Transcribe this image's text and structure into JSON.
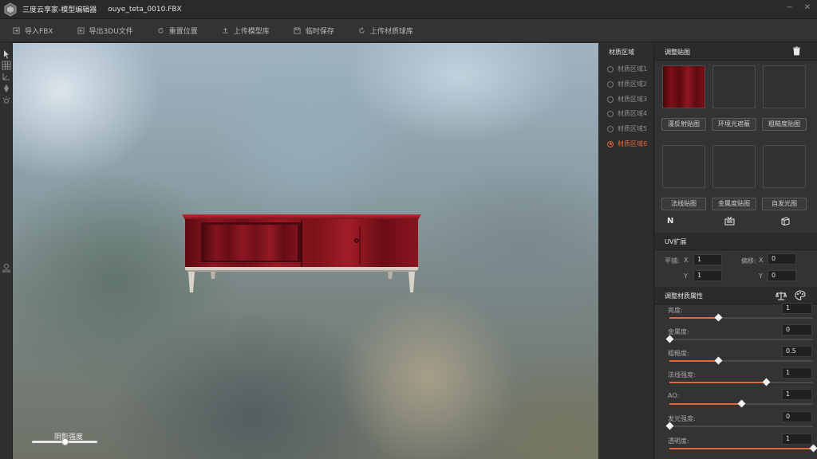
{
  "titlebar": {
    "app_title": "三度云享家-模型编辑器",
    "file_name": "ouye_teta_0010.FBX",
    "minimize": "−",
    "close": "✕"
  },
  "toolbar": [
    {
      "label": "导入FBX",
      "icon": "import-icon"
    },
    {
      "label": "导出3DU文件",
      "icon": "export-icon"
    },
    {
      "label": "重置位置",
      "icon": "reset-icon"
    },
    {
      "label": "上传模型库",
      "icon": "upload-icon"
    },
    {
      "label": "临时保存",
      "icon": "save-icon"
    },
    {
      "label": "上传材质球库",
      "icon": "sync-icon"
    }
  ],
  "viewport": {
    "shadow_label": "阴影强度",
    "shadow_value": 0.5
  },
  "regions": {
    "title": "材质区域",
    "items": [
      "材质区域1",
      "材质区域2",
      "材质区域3",
      "材质区域4",
      "材质区域5",
      "材质区域6"
    ],
    "selected_index": 5,
    "accent": "#e4663a"
  },
  "textures": {
    "title": "调整贴图",
    "buttons": [
      "漫反射贴图",
      "环境光遮蔽",
      "粗糙度贴图",
      "法线贴图",
      "金属度贴图",
      "自发光图"
    ],
    "normal_icon_text": "N"
  },
  "uv": {
    "title": "UV扩展",
    "tile_label": "平铺:",
    "offset_label": "偏移:",
    "x_label": "X",
    "y_label": "Y",
    "tile_x": "1",
    "tile_y": "1",
    "offset_x": "0",
    "offset_y": "0"
  },
  "material": {
    "title": "调整材质属性",
    "props": [
      {
        "label": "亮度:",
        "value": "1",
        "level": 0.34
      },
      {
        "label": "金属度:",
        "value": "0",
        "level": 0.0
      },
      {
        "label": "粗糙度:",
        "value": "0.5",
        "level": 0.34
      },
      {
        "label": "法线强度:",
        "value": "1",
        "level": 0.67
      },
      {
        "label": "AO:",
        "value": "1",
        "level": 0.5
      },
      {
        "label": "发光强度:",
        "value": "0",
        "level": 0.0
      },
      {
        "label": "透明度:",
        "value": "1",
        "level": 1.0
      }
    ]
  }
}
